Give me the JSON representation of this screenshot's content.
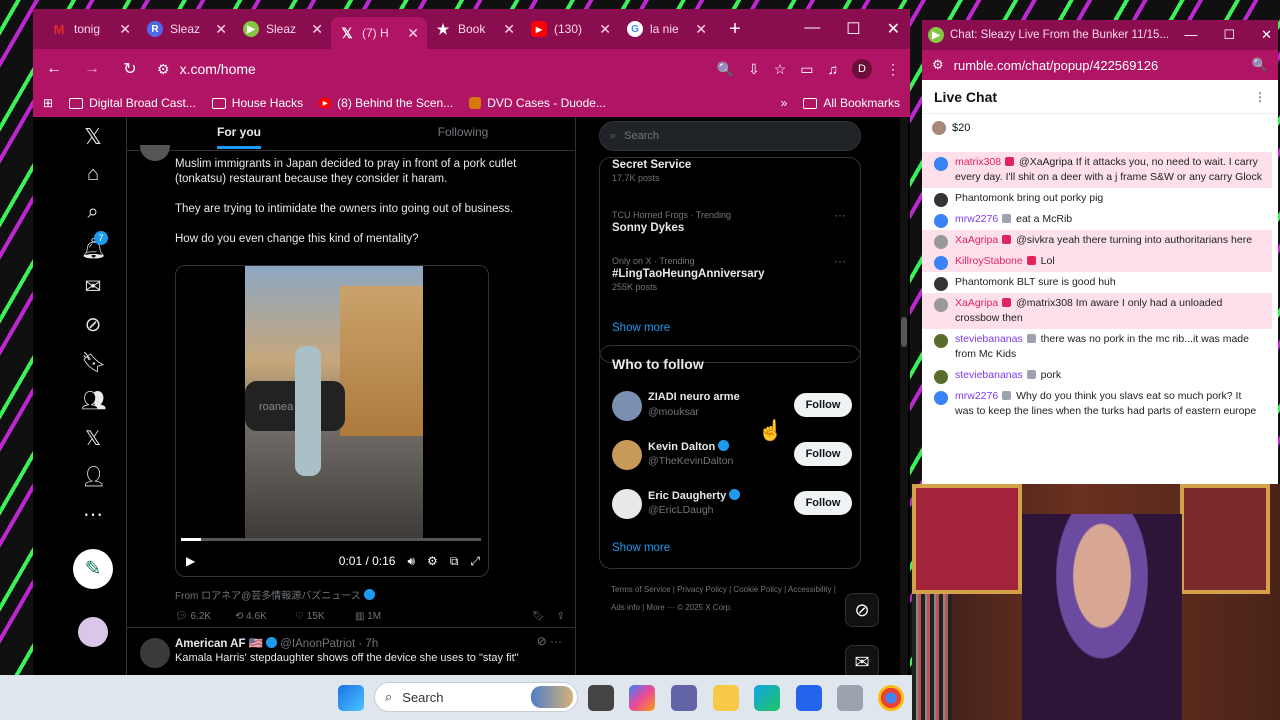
{
  "browser": {
    "tabs": [
      {
        "icon": "gmail-icon",
        "label": "tonig",
        "color": "#ffffff",
        "glyph": "M",
        "fg": "#d93025"
      },
      {
        "icon": "r-icon",
        "label": "Sleaz",
        "color": "#4f6ae8",
        "glyph": "R",
        "fg": "#ffffff"
      },
      {
        "icon": "rumble-icon",
        "label": "Sleaz",
        "color": "#85c742",
        "glyph": "▶",
        "fg": "#ffffff"
      },
      {
        "icon": "x-icon",
        "label": "(7) H",
        "color": "#000000",
        "glyph": "𝕏",
        "fg": "#ffffff"
      },
      {
        "icon": "star-icon",
        "label": "Book",
        "color": "transparent",
        "glyph": "★",
        "fg": "#ffffff"
      },
      {
        "icon": "youtube-icon",
        "label": "(130)",
        "color": "#ff0000",
        "glyph": "▶",
        "fg": "#ffffff"
      },
      {
        "icon": "google-icon",
        "label": "la nie",
        "color": "#ffffff",
        "glyph": "G",
        "fg": "#4285f4"
      }
    ],
    "url": "x.com/home",
    "profile_initial": "D",
    "bookmarks": [
      "Digital Broad Cast...",
      "House Hacks",
      "(8) Behind the Scen...",
      "DVD Cases - Duode..."
    ],
    "all_bookmarks": "All Bookmarks"
  },
  "x": {
    "tabs": {
      "for_you": "For you",
      "following": "Following"
    },
    "notif_count": "7",
    "post": {
      "line1": "Muslim immigrants in Japan decided to pray in front of a pork cutlet",
      "line2": "(tonkatsu) restaurant because they consider it haram.",
      "line3": "They are trying to intimidate the owners into going out of business.",
      "line4": "How do you even change this kind of mentality?",
      "video_time": "0:01 / 0:16",
      "watermark": "roanea",
      "from": "From ロアネア@芸多情報源バズニュース",
      "replies": "6.2K",
      "reposts": "4.6K",
      "likes": "15K",
      "views": "1M"
    },
    "post2": {
      "author": "American AF 🇺🇸",
      "handle": "@IAnonPatriot · 7h",
      "text": "Kamala Harris' stepdaughter shows off the device she uses to \"stay fit\""
    },
    "search_placeholder": "Search",
    "trends": [
      {
        "meta": "",
        "name": "Secret Service",
        "posts": "17.7K posts"
      },
      {
        "meta": "TCU Horned Frogs · Trending",
        "name": "Sonny Dykes",
        "posts": ""
      },
      {
        "meta": "Only on X · Trending",
        "name": "#LingTaoHeungAnniversary",
        "posts": "255K posts"
      }
    ],
    "show_more": "Show more",
    "who_to_follow": "Who to follow",
    "follow_suggestions": [
      {
        "name": "ZIADI neuro arme",
        "handle": "@mouksar",
        "verified": false,
        "avatar": "#7b8fb0"
      },
      {
        "name": "Kevin Dalton",
        "handle": "@TheKevinDalton",
        "verified": true,
        "avatar": "#c89a5a"
      },
      {
        "name": "Eric Daugherty",
        "handle": "@EricLDaugh",
        "verified": true,
        "avatar": "#e8e8e8"
      }
    ],
    "follow_label": "Follow",
    "footer": "Terms of Service  |  Privacy Policy  |  Cookie Policy  |  Accessibility  |  Ads info  |  More ···  © 2025 X Corp."
  },
  "chat_window": {
    "title": "Chat: Sleazy Live From the Bunker 11/15...",
    "url": "rumble.com/chat/popup/422569126",
    "heading": "Live Chat",
    "tip": "$20",
    "messages": [
      {
        "user": "matrix308",
        "color": "red",
        "text": "@XaAgripa If it attacks you, no need to wait. I carry every day. I'll shit on a deer with a j frame S&W or any carry Glock",
        "highlight": true,
        "icon": "#3b82f6"
      },
      {
        "user": "Phantomonk",
        "color": "plain",
        "text": "bring out porky pig",
        "highlight": false,
        "icon": "#333333"
      },
      {
        "user": "mrw2276",
        "color": "grn",
        "text": "eat a McRib",
        "highlight": false,
        "icon": "#3b82f6"
      },
      {
        "user": "XaAgripa",
        "color": "red",
        "text": "@sivkra yeah there turning into authoritarians here",
        "highlight": true,
        "icon": "#999999"
      },
      {
        "user": "KillroyStabone",
        "color": "red",
        "text": "Lol",
        "highlight": true,
        "icon": "#3b82f6"
      },
      {
        "user": "Phantomonk",
        "color": "plain",
        "text": "BLT sure is good huh",
        "highlight": false,
        "icon": "#333333"
      },
      {
        "user": "XaAgripa",
        "color": "red",
        "text": "@matrix308 Im aware I only had a unloaded crossbow then",
        "highlight": true,
        "icon": "#999999"
      },
      {
        "user": "steviebananas",
        "color": "grn",
        "text": "there was no pork in the mc rib...it was made from Mc Kids",
        "highlight": false,
        "icon": "#5a6b2a"
      },
      {
        "user": "steviebananas",
        "color": "grn",
        "text": "pork",
        "highlight": false,
        "icon": "#5a6b2a"
      },
      {
        "user": "mrw2276",
        "color": "grn",
        "text": "Why do you think you slavs eat so much pork? It was to keep the lines when the turks had parts of eastern europe",
        "highlight": false,
        "icon": "#3b82f6"
      }
    ]
  },
  "taskbar": {
    "search_label": "Search"
  }
}
